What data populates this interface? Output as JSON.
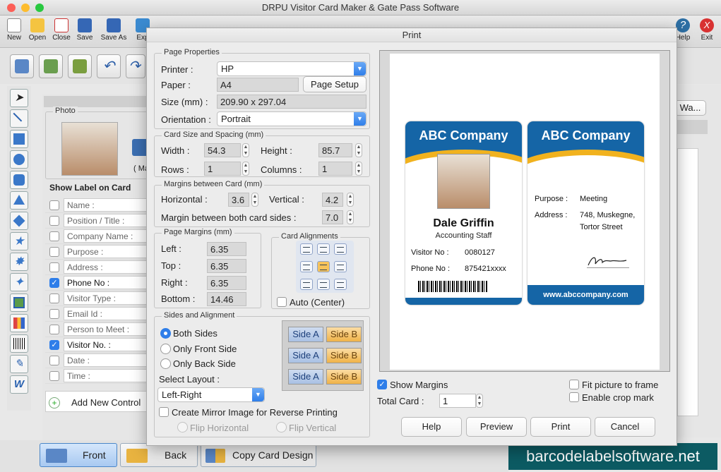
{
  "app": {
    "title": "DRPU Visitor Card Maker & Gate Pass Software"
  },
  "toolbar": {
    "items": [
      {
        "label": "New",
        "icon": "new-icon"
      },
      {
        "label": "Open",
        "icon": "open-icon"
      },
      {
        "label": "Close",
        "icon": "close-doc-icon"
      },
      {
        "label": "Save",
        "icon": "save-icon"
      },
      {
        "label": "Save As",
        "icon": "save-as-icon"
      },
      {
        "label": "Exp",
        "icon": "export-icon"
      }
    ],
    "help_label": "Help",
    "exit_label": "Exit"
  },
  "left_panel": {
    "photo_label": "Photo",
    "photo_sub": "( Ma",
    "show_label": "Show Label on Card",
    "fields": [
      {
        "label": "Name :",
        "checked": false
      },
      {
        "label": "Position / Title :",
        "checked": false
      },
      {
        "label": "Company Name :",
        "checked": false
      },
      {
        "label": "Purpose :",
        "checked": false
      },
      {
        "label": "Address :",
        "checked": false
      },
      {
        "label": "Phone No :",
        "checked": true
      },
      {
        "label": "Visitor Type :",
        "checked": false
      },
      {
        "label": "Email Id :",
        "checked": false
      },
      {
        "label": "Person to Meet :",
        "checked": false
      },
      {
        "label": "Visitor No. :",
        "checked": true
      },
      {
        "label": "Date :",
        "checked": false
      },
      {
        "label": "Time :",
        "checked": false
      }
    ],
    "add_control": "Add New Control",
    "right_btn": "Wa..."
  },
  "bottom": {
    "front": "Front",
    "back": "Back",
    "copy": "Copy Card Design"
  },
  "watermark": "barcodelabelsoftware.net",
  "dialog": {
    "title": "Print",
    "page_props": {
      "legend": "Page Properties",
      "printer_label": "Printer :",
      "printer": "HP",
      "paper_label": "Paper :",
      "paper": "A4",
      "page_setup": "Page Setup",
      "size_label": "Size (mm) :",
      "size": "209.90 x 297.04",
      "orient_label": "Orientation :",
      "orientation": "Portrait"
    },
    "card_size": {
      "legend": "Card Size and Spacing (mm)",
      "width_label": "Width :",
      "width": "54.3",
      "height_label": "Height :",
      "height": "85.7",
      "rows_label": "Rows :",
      "rows": "1",
      "cols_label": "Columns :",
      "cols": "1"
    },
    "margins_between": {
      "legend": "Margins between Card (mm)",
      "h_label": "Horizontal :",
      "h": "3.6",
      "v_label": "Vertical :",
      "v": "4.2",
      "both_label": "Margin between both card sides :",
      "both": "7.0"
    },
    "page_margins": {
      "legend": "Page Margins (mm)",
      "left_label": "Left :",
      "left": "6.35",
      "top_label": "Top :",
      "top": "6.35",
      "right_label": "Right :",
      "right": "6.35",
      "bottom_label": "Bottom :",
      "bottom": "14.46"
    },
    "card_align": {
      "legend": "Card Alignments",
      "auto": "Auto (Center)"
    },
    "sides": {
      "legend": "Sides and Alignment",
      "both": "Both Sides",
      "front": "Only Front Side",
      "back": "Only Back Side",
      "layout_label": "Select Layout :",
      "layout": "Left-Right",
      "side_a": "Side A",
      "side_b": "Side B"
    },
    "mirror": "Create Mirror Image for Reverse Printing",
    "flip_h": "Flip Horizontal",
    "flip_v": "Flip Vertical",
    "show_margins": "Show Margins",
    "total_label": "Total Card :",
    "total": "1",
    "fit": "Fit picture to frame",
    "crop": "Enable crop mark",
    "buttons": {
      "help": "Help",
      "preview": "Preview",
      "print": "Print",
      "cancel": "Cancel"
    }
  },
  "card": {
    "company": "ABC Company",
    "name": "Dale Griffin",
    "title": "Accounting Staff",
    "visitor_label": "Visitor No :",
    "visitor": "0080127",
    "phone_label": "Phone No :",
    "phone": "875421xxxx",
    "purpose_label": "Purpose :",
    "purpose": "Meeting",
    "address_label": "Address :",
    "address1": "748, Muskegne,",
    "address2": "Tortor Street",
    "website": "www.abccompany.com"
  }
}
